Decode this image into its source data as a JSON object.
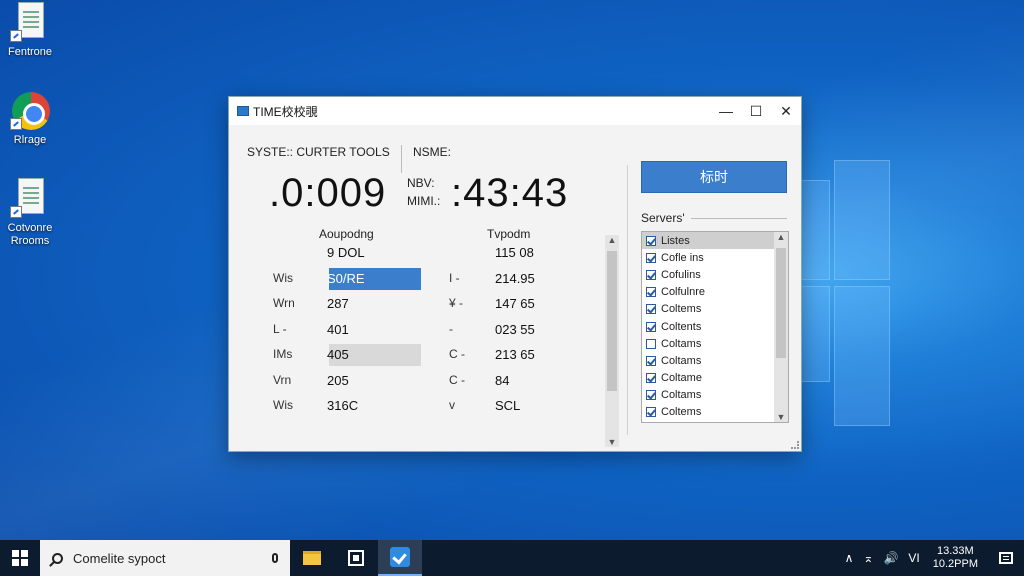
{
  "desktop": {
    "icons": [
      {
        "label": "Fentrone"
      },
      {
        "label": "Rlrage"
      },
      {
        "label": "Cotvonre Rrooms"
      }
    ]
  },
  "window": {
    "title": "TIME校校覗",
    "minimize": "—",
    "maximize": "☐",
    "close": "✕",
    "system_label": "SYSTE:: CURTER TOOLS",
    "name_label": "NSME:",
    "time_left": ".0:009",
    "nbv_label": "NBV:",
    "mimi_label": "MIMI.:",
    "time_right": ":43:43",
    "col_left_header": "Aoupodng",
    "col_right_header": "Tvpodm",
    "rows": [
      {
        "l1": "",
        "v1": "9 DOL",
        "l2": "",
        "v2": "115 08"
      },
      {
        "l1": "Wis",
        "v1": "S0/RE",
        "l2": "I -",
        "v2": "214.95"
      },
      {
        "l1": "Wrn",
        "v1": "287",
        "l2": "¥ -",
        "v2": "147 65"
      },
      {
        "l1": "L -",
        "v1": "401",
        "l2": "-",
        "v2": "023 55"
      },
      {
        "l1": "IMs",
        "v1": "405",
        "l2": "C -",
        "v2": "213 65"
      },
      {
        "l1": "Vrn",
        "v1": "205",
        "l2": "C -",
        "v2": "84"
      },
      {
        "l1": "Wis",
        "v1": "316C",
        "l2": "v",
        "v2": "SCL"
      }
    ],
    "action_button": "标时",
    "servers_label": "Servers'",
    "server_list": [
      {
        "label": "Listes",
        "checked": true
      },
      {
        "label": "Cofle ins",
        "checked": true
      },
      {
        "label": "Cofulins",
        "checked": true
      },
      {
        "label": "Colfulnre",
        "checked": true
      },
      {
        "label": "Coltems",
        "checked": true
      },
      {
        "label": "Coltents",
        "checked": true
      },
      {
        "label": "Coltams",
        "checked": false
      },
      {
        "label": "Coltams",
        "checked": true
      },
      {
        "label": "Coltame",
        "checked": true
      },
      {
        "label": "Coltams",
        "checked": true
      },
      {
        "label": "Coltems",
        "checked": true
      }
    ]
  },
  "taskbar": {
    "search_text": "Comelite sypoct",
    "tray_chevron": "∧",
    "tray_network": "⌅",
    "tray_volume": "🔊",
    "tray_lang": "VI",
    "clock_time": "13.33M",
    "clock_date": "10.2PPM"
  }
}
